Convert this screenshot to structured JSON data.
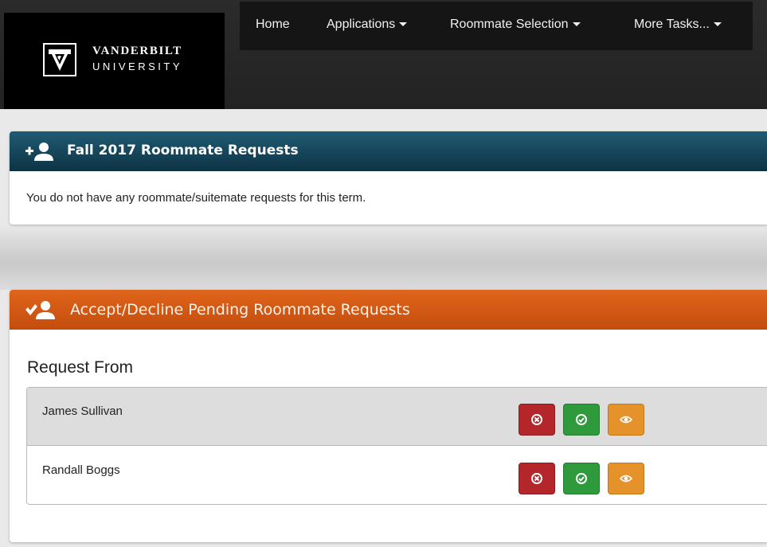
{
  "brand": {
    "name_line1": "VANDERBILT",
    "name_line2": "UNIVERSITY"
  },
  "nav": {
    "items": [
      {
        "label": "Home",
        "dropdown": false
      },
      {
        "label": "Applications",
        "dropdown": true
      },
      {
        "label": "Roommate Selection",
        "dropdown": true
      },
      {
        "label": "More Tasks...",
        "dropdown": true
      }
    ]
  },
  "roommate_requests_panel": {
    "title": "Fall 2017 Roommate Requests",
    "icon": "add-user-icon",
    "header_color": "#1a4d63",
    "message": "You do not have any roommate/suitemate requests for this term."
  },
  "pending_panel": {
    "title": "Accept/Decline Pending Roommate Requests",
    "icon": "check-user-icon",
    "header_color": "#d85a14",
    "list_heading": "Request From",
    "requests": [
      {
        "name": "James Sullivan"
      },
      {
        "name": "Randall Boggs"
      }
    ],
    "action_icons": {
      "decline": "close-circle-icon",
      "accept": "check-circle-icon",
      "view": "eye-icon"
    },
    "action_colors": {
      "decline": "#b3262a",
      "accept": "#2f9a3c",
      "view": "#e6922a"
    }
  }
}
